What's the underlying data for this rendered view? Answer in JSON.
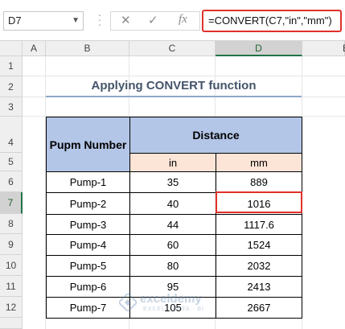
{
  "formula_bar": {
    "name_box": "D7",
    "cancel_icon": "✕",
    "enter_icon": "✓",
    "fx_icon": "fx",
    "formula": "=CONVERT(C7,\"in\",\"mm\")"
  },
  "columns": [
    "A",
    "B",
    "C",
    "D",
    "E"
  ],
  "rows": [
    "1",
    "2",
    "3",
    "4",
    "5",
    "6",
    "7",
    "8",
    "9",
    "10",
    "11",
    "12"
  ],
  "selected_cell": "D7",
  "title": "Applying CONVERT function",
  "table": {
    "header_pump": "Pupm Number",
    "header_distance": "Distance",
    "unit_in": "in",
    "unit_mm": "mm",
    "rows": [
      {
        "pump": "Pump-1",
        "in": "35",
        "mm": "889"
      },
      {
        "pump": "Pump-2",
        "in": "40",
        "mm": "1016"
      },
      {
        "pump": "Pump-3",
        "in": "44",
        "mm": "1117.6"
      },
      {
        "pump": "Pump-4",
        "in": "60",
        "mm": "1524"
      },
      {
        "pump": "Pump-5",
        "in": "80",
        "mm": "2032"
      },
      {
        "pump": "Pump-6",
        "in": "95",
        "mm": "2413"
      },
      {
        "pump": "Pump-7",
        "in": "105",
        "mm": "2667"
      }
    ]
  },
  "watermark": {
    "name": "exceldemy",
    "tagline": "EXCEL · DATA · BI"
  },
  "colors": {
    "selection": "#e0312b",
    "header_fill": "#b4c6e7",
    "unit_fill": "#fce4d6",
    "title": "#44546a"
  }
}
